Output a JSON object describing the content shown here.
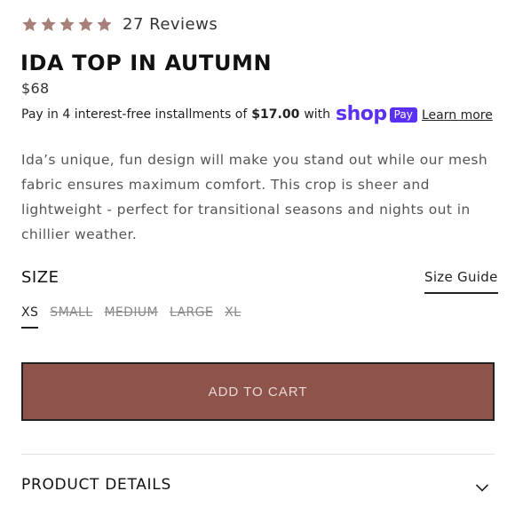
{
  "rating": {
    "stars": 5,
    "reviews_text": "27 Reviews",
    "star_color": "#a8807a"
  },
  "product": {
    "title": "IDA TOP IN AUTUMN",
    "price": "$68"
  },
  "installments": {
    "prefix": "Pay in 4 interest-free installments of",
    "amount": "$17.00",
    "suffix": "with",
    "brand_word": "shop",
    "brand_badge": "Pay",
    "brand_color": "#5a31f4",
    "learn_more": "Learn more"
  },
  "description": "Ida’s unique, fun design will make you stand out while our mesh fabric ensures maximum comfort. This crop is sheer and lightweight - perfect for transitional seasons and nights out in chillier weather.",
  "size": {
    "label": "SIZE",
    "guide": "Size Guide",
    "options": [
      {
        "label": "XS",
        "selected": true,
        "available": true
      },
      {
        "label": "SMALL",
        "selected": false,
        "available": false
      },
      {
        "label": "MEDIUM",
        "selected": false,
        "available": false
      },
      {
        "label": "LARGE",
        "selected": false,
        "available": false
      },
      {
        "label": "XL",
        "selected": false,
        "available": false
      }
    ]
  },
  "cart": {
    "button_label": "ADD TO CART",
    "button_color": "#8e534a"
  },
  "details": {
    "label": "PRODUCT DETAILS",
    "icon": "chevron-down-icon"
  }
}
